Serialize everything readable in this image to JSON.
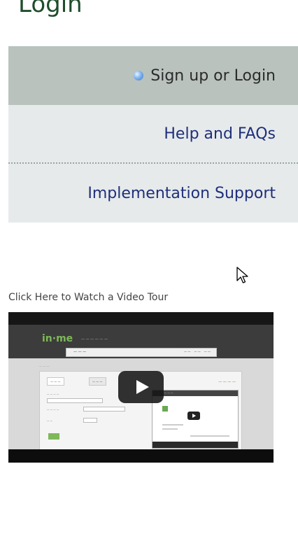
{
  "page": {
    "heading": "Login"
  },
  "menu": {
    "items": [
      {
        "label": "Sign up or Login"
      },
      {
        "label": "Help and FAQs"
      },
      {
        "label": "Implementation Support"
      }
    ]
  },
  "video": {
    "caption": "Click Here to Watch a Video Tour"
  },
  "colors": {
    "active_bg": "#b9c2bd",
    "inactive_bg": "#e6eaeb",
    "link_text": "#1f2f7a",
    "heading_green": "#1f4d2b"
  },
  "icons": {
    "bullet": "blue-dot-icon",
    "cursor": "mouse-pointer-icon",
    "play": "play-icon"
  }
}
